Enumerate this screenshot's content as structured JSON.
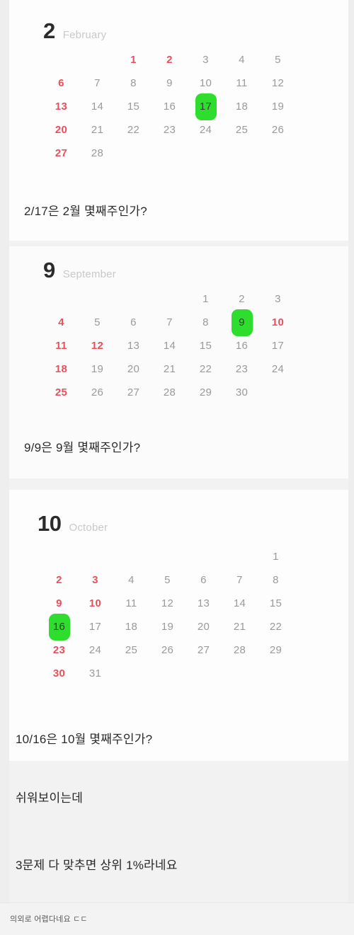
{
  "page": {
    "background": "#f2f2f2",
    "panel_background": "#fdfdfd",
    "highlight_color": "#2fdd2f",
    "holiday_color": "#e8505b",
    "weekday_color": "#9a9a9a"
  },
  "sections": [
    {
      "id": "february",
      "month_number": "2",
      "month_name": "February",
      "highlight_day": "17",
      "question": "2/17은 2월 몇째주인가?",
      "weeks": [
        [
          "",
          "",
          "1",
          "2",
          "3",
          "4",
          "5"
        ],
        [
          "6",
          "7",
          "8",
          "9",
          "10",
          "11",
          "12"
        ],
        [
          "13",
          "14",
          "15",
          "16",
          "17",
          "18",
          "19"
        ],
        [
          "20",
          "21",
          "22",
          "23",
          "24",
          "25",
          "26"
        ],
        [
          "27",
          "28",
          "",
          "",
          "",
          "",
          ""
        ]
      ],
      "red_days": [
        "1",
        "2",
        "6",
        "13",
        "20",
        "27"
      ]
    },
    {
      "id": "september",
      "month_number": "9",
      "month_name": "September",
      "highlight_day": "9",
      "question": "9/9은 9월 몇째주인가?",
      "weeks": [
        [
          "",
          "",
          "",
          "",
          "1",
          "2",
          "3"
        ],
        [
          "4",
          "5",
          "6",
          "7",
          "8",
          "9",
          "10"
        ],
        [
          "11",
          "12",
          "13",
          "14",
          "15",
          "16",
          "17"
        ],
        [
          "18",
          "19",
          "20",
          "21",
          "22",
          "23",
          "24"
        ],
        [
          "25",
          "26",
          "27",
          "28",
          "29",
          "30",
          ""
        ]
      ],
      "red_days": [
        "4",
        "10",
        "11",
        "12",
        "18",
        "25"
      ]
    },
    {
      "id": "october",
      "month_number": "10",
      "month_name": "October",
      "highlight_day": "16",
      "question": "10/16은 10월 몇째주인가?",
      "weeks": [
        [
          "",
          "",
          "",
          "",
          "",
          "",
          "1"
        ],
        [
          "2",
          "3",
          "4",
          "5",
          "6",
          "7",
          "8"
        ],
        [
          "9",
          "10",
          "11",
          "12",
          "13",
          "14",
          "15"
        ],
        [
          "16",
          "17",
          "18",
          "19",
          "20",
          "21",
          "22"
        ],
        [
          "23",
          "24",
          "25",
          "26",
          "27",
          "28",
          "29"
        ],
        [
          "30",
          "31",
          "",
          "",
          "",
          "",
          ""
        ]
      ],
      "red_days": [
        "2",
        "3",
        "9",
        "10",
        "16",
        "23",
        "30"
      ]
    }
  ],
  "closing": {
    "line1": "쉬워보이는데",
    "line2": "3문제  다  맞추면  상위  1%라네요"
  },
  "caption": {
    "text": "의외로 어렵다네요 ㄷㄷ"
  }
}
